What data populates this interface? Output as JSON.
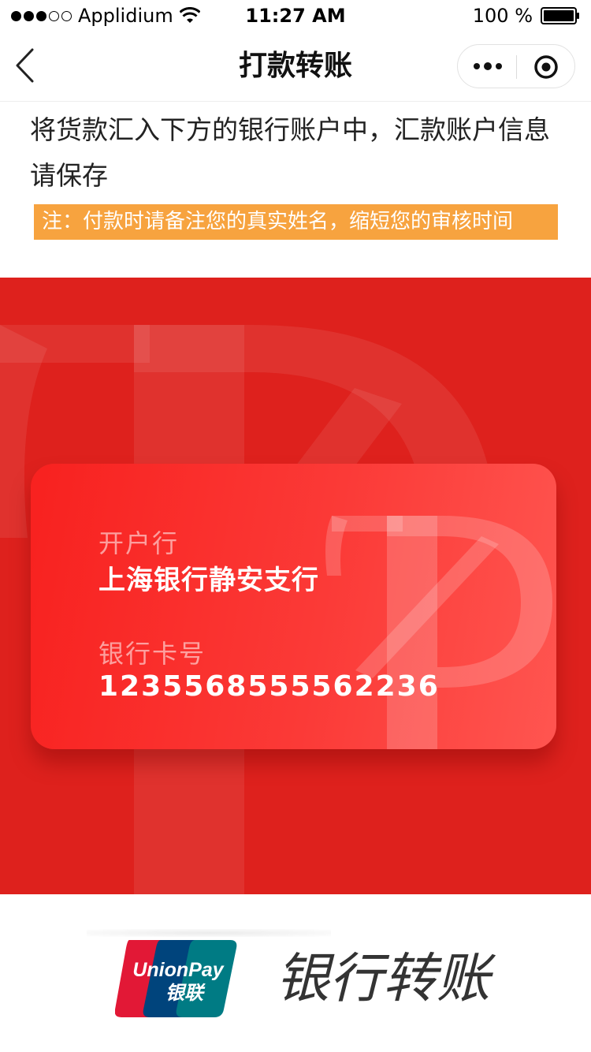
{
  "status_bar": {
    "carrier": "Applidium",
    "time": "11:27 AM",
    "battery": "100 %"
  },
  "nav": {
    "title": "打款转账"
  },
  "intro": {
    "text": "将货款汇入下方的银行账户中，汇款账户信息请保存",
    "notice": "注：付款时请备注您的真实姓名，缩短您的审核时间"
  },
  "card": {
    "bank_label": "开户行",
    "bank_name": "上海银行静安支行",
    "card_label": "银行卡号",
    "card_number": "1235568555562236"
  },
  "footer": {
    "logo_text_top": "UnionPay",
    "logo_text_bottom": "银联",
    "title": "银行转账"
  },
  "colors": {
    "panel_red": "#de211d",
    "notice_orange": "#f7a33f"
  }
}
